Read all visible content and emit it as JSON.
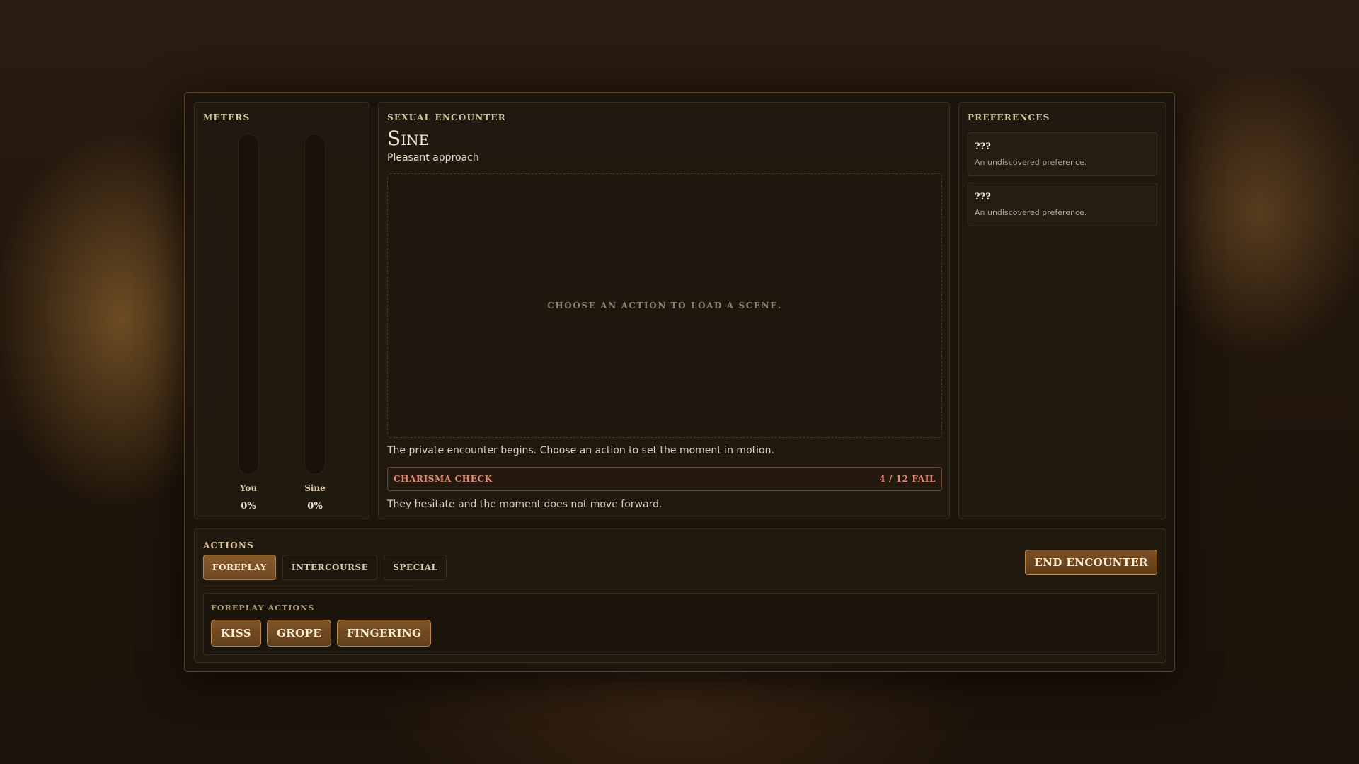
{
  "meters": {
    "title": "METERS",
    "items": [
      {
        "name": "You",
        "percent": "0%",
        "fill": 0
      },
      {
        "name": "Sine",
        "percent": "0%",
        "fill": 0
      }
    ]
  },
  "encounter": {
    "title": "SEXUAL ENCOUNTER",
    "character": "Sine",
    "approach": "Pleasant approach",
    "scene_placeholder": "CHOOSE AN ACTION TO LOAD A SCENE.",
    "log_intro": "The private encounter begins. Choose an action to set the moment in motion.",
    "check": {
      "label": "CHARISMA CHECK",
      "result": "4 / 12 FAIL"
    },
    "log_result": "They hesitate and the moment does not move forward."
  },
  "preferences": {
    "title": "PREFERENCES",
    "items": [
      {
        "name": "???",
        "desc": "An undiscovered preference."
      },
      {
        "name": "???",
        "desc": "An undiscovered preference."
      }
    ]
  },
  "actions": {
    "title": "ACTIONS",
    "tabs": [
      {
        "label": "FOREPLAY",
        "active": true
      },
      {
        "label": "INTERCOURSE",
        "active": false
      },
      {
        "label": "SPECIAL",
        "active": false
      }
    ],
    "end_label": "END ENCOUNTER",
    "sub_title": "FOREPLAY ACTIONS",
    "buttons": [
      "KISS",
      "GROPE",
      "FINGERING"
    ]
  },
  "colors": {
    "accent": "#7a5026",
    "fail": "#e08f78"
  }
}
